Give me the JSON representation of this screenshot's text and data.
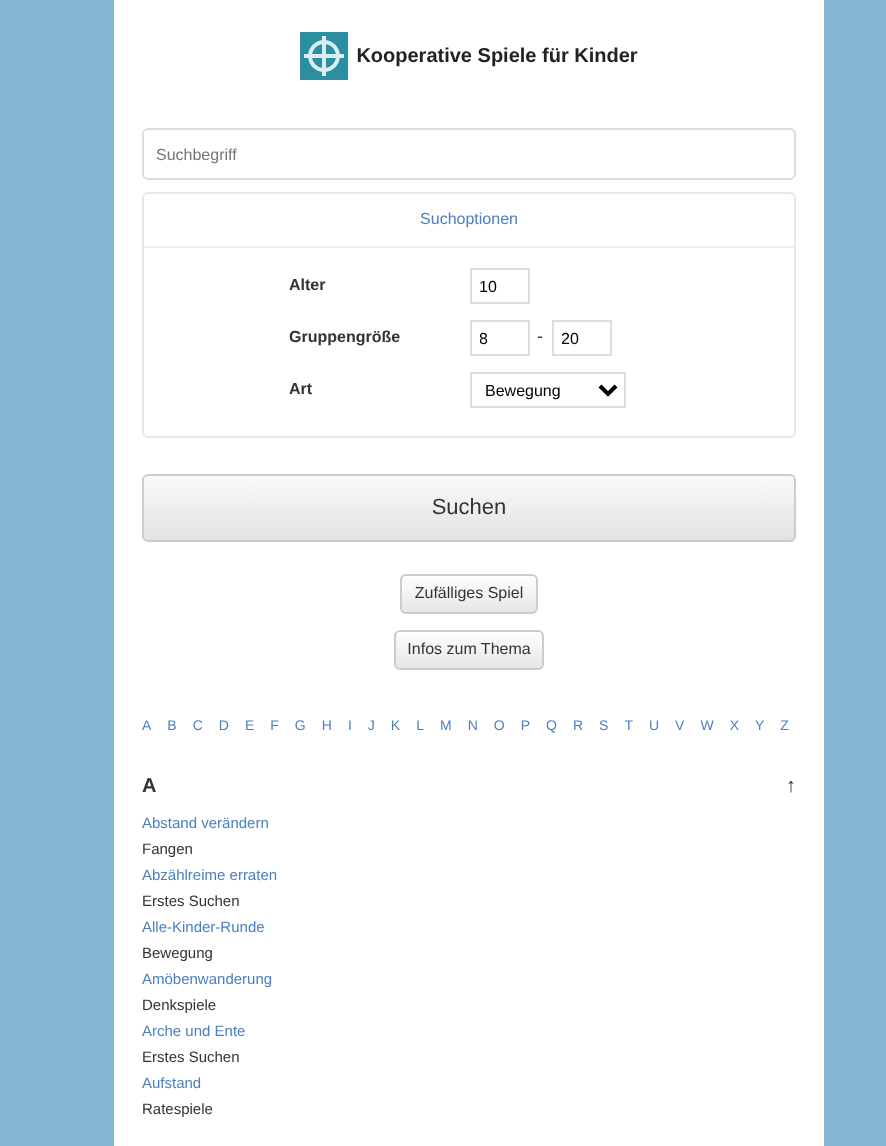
{
  "header": {
    "title": "Kooperative Spiele für Kinder"
  },
  "search": {
    "placeholder": "Suchbegriff"
  },
  "options": {
    "link": "Suchoptionen",
    "age_label": "Alter",
    "age_value": "10",
    "group_label": "Gruppengröße",
    "group_min": "8",
    "group_sep": "-",
    "group_max": "20",
    "type_label": "Art",
    "type_value": "Bewegung"
  },
  "search_button": "Suchen",
  "buttons": [
    "Zufälliges Spiel",
    "Infos zum Thema"
  ],
  "alphabet": [
    "A",
    "B",
    "C",
    "D",
    "E",
    "F",
    "G",
    "H",
    "I",
    "J",
    "K",
    "L",
    "M",
    "N",
    "O",
    "P",
    "Q",
    "R",
    "S",
    "T",
    "U",
    "V",
    "W",
    "X",
    "Y",
    "Z"
  ],
  "section": {
    "letter": "A",
    "top_link": "↑"
  },
  "entries": [
    {
      "kind": "game",
      "text": "Abstand verändern"
    },
    {
      "kind": "category",
      "text": "Fangen"
    },
    {
      "kind": "game",
      "text": "Abzählreime erraten"
    },
    {
      "kind": "category",
      "text": "Erstes Suchen"
    },
    {
      "kind": "game",
      "text": "Alle-Kinder-Runde"
    },
    {
      "kind": "category",
      "text": "Bewegung"
    },
    {
      "kind": "game",
      "text": "Amöbenwanderung"
    },
    {
      "kind": "category",
      "text": "Denkspiele"
    },
    {
      "kind": "game",
      "text": "Arche und Ente"
    },
    {
      "kind": "category",
      "text": "Erstes Suchen"
    },
    {
      "kind": "game",
      "text": "Aufstand"
    },
    {
      "kind": "category",
      "text": "Ratespiele"
    }
  ]
}
